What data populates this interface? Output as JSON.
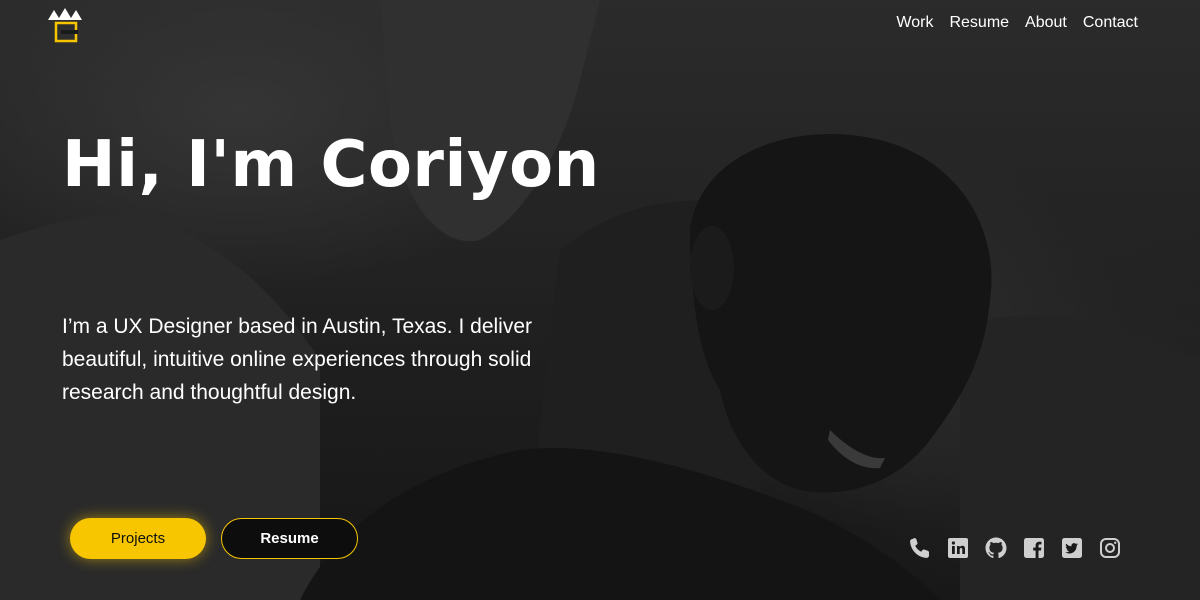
{
  "nav": {
    "items": [
      {
        "label": "Work"
      },
      {
        "label": "Resume"
      },
      {
        "label": "About"
      },
      {
        "label": "Contact"
      }
    ]
  },
  "logo": {
    "icon": "crown-c-logo",
    "accent": "#f7c600"
  },
  "hero": {
    "title": "Hi, I'm Coriyon",
    "intro": "I’m a UX Designer based in Austin, Texas. I deliver beautiful, intuitive online experiences through solid research and thoughtful design."
  },
  "buttons": {
    "projects_label": "Projects",
    "resume_label": "Resume"
  },
  "socials": [
    {
      "icon": "phone-icon"
    },
    {
      "icon": "linkedin-icon"
    },
    {
      "icon": "github-icon"
    },
    {
      "icon": "facebook-icon"
    },
    {
      "icon": "twitter-icon"
    },
    {
      "icon": "instagram-icon"
    }
  ],
  "colors": {
    "accent": "#f7c600",
    "text": "#ffffff",
    "background": "#1a1a1a"
  }
}
